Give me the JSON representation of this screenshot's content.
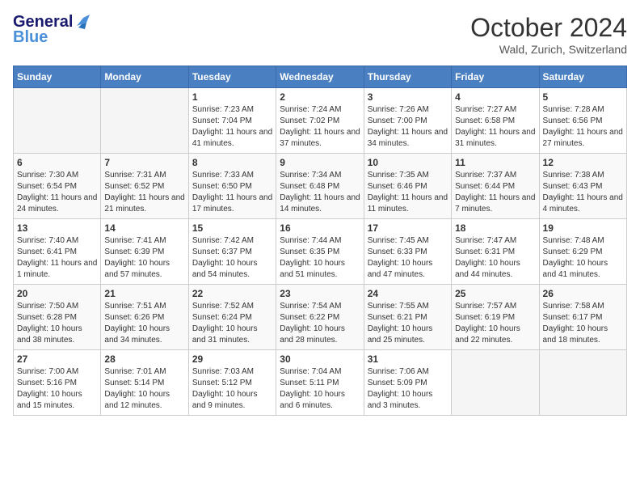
{
  "logo": {
    "general": "General",
    "blue": "Blue"
  },
  "title": "October 2024",
  "location": "Wald, Zurich, Switzerland",
  "headers": [
    "Sunday",
    "Monday",
    "Tuesday",
    "Wednesday",
    "Thursday",
    "Friday",
    "Saturday"
  ],
  "weeks": [
    [
      {
        "day": "",
        "info": ""
      },
      {
        "day": "",
        "info": ""
      },
      {
        "day": "1",
        "info": "Sunrise: 7:23 AM\nSunset: 7:04 PM\nDaylight: 11 hours and 41 minutes."
      },
      {
        "day": "2",
        "info": "Sunrise: 7:24 AM\nSunset: 7:02 PM\nDaylight: 11 hours and 37 minutes."
      },
      {
        "day": "3",
        "info": "Sunrise: 7:26 AM\nSunset: 7:00 PM\nDaylight: 11 hours and 34 minutes."
      },
      {
        "day": "4",
        "info": "Sunrise: 7:27 AM\nSunset: 6:58 PM\nDaylight: 11 hours and 31 minutes."
      },
      {
        "day": "5",
        "info": "Sunrise: 7:28 AM\nSunset: 6:56 PM\nDaylight: 11 hours and 27 minutes."
      }
    ],
    [
      {
        "day": "6",
        "info": "Sunrise: 7:30 AM\nSunset: 6:54 PM\nDaylight: 11 hours and 24 minutes."
      },
      {
        "day": "7",
        "info": "Sunrise: 7:31 AM\nSunset: 6:52 PM\nDaylight: 11 hours and 21 minutes."
      },
      {
        "day": "8",
        "info": "Sunrise: 7:33 AM\nSunset: 6:50 PM\nDaylight: 11 hours and 17 minutes."
      },
      {
        "day": "9",
        "info": "Sunrise: 7:34 AM\nSunset: 6:48 PM\nDaylight: 11 hours and 14 minutes."
      },
      {
        "day": "10",
        "info": "Sunrise: 7:35 AM\nSunset: 6:46 PM\nDaylight: 11 hours and 11 minutes."
      },
      {
        "day": "11",
        "info": "Sunrise: 7:37 AM\nSunset: 6:44 PM\nDaylight: 11 hours and 7 minutes."
      },
      {
        "day": "12",
        "info": "Sunrise: 7:38 AM\nSunset: 6:43 PM\nDaylight: 11 hours and 4 minutes."
      }
    ],
    [
      {
        "day": "13",
        "info": "Sunrise: 7:40 AM\nSunset: 6:41 PM\nDaylight: 11 hours and 1 minute."
      },
      {
        "day": "14",
        "info": "Sunrise: 7:41 AM\nSunset: 6:39 PM\nDaylight: 10 hours and 57 minutes."
      },
      {
        "day": "15",
        "info": "Sunrise: 7:42 AM\nSunset: 6:37 PM\nDaylight: 10 hours and 54 minutes."
      },
      {
        "day": "16",
        "info": "Sunrise: 7:44 AM\nSunset: 6:35 PM\nDaylight: 10 hours and 51 minutes."
      },
      {
        "day": "17",
        "info": "Sunrise: 7:45 AM\nSunset: 6:33 PM\nDaylight: 10 hours and 47 minutes."
      },
      {
        "day": "18",
        "info": "Sunrise: 7:47 AM\nSunset: 6:31 PM\nDaylight: 10 hours and 44 minutes."
      },
      {
        "day": "19",
        "info": "Sunrise: 7:48 AM\nSunset: 6:29 PM\nDaylight: 10 hours and 41 minutes."
      }
    ],
    [
      {
        "day": "20",
        "info": "Sunrise: 7:50 AM\nSunset: 6:28 PM\nDaylight: 10 hours and 38 minutes."
      },
      {
        "day": "21",
        "info": "Sunrise: 7:51 AM\nSunset: 6:26 PM\nDaylight: 10 hours and 34 minutes."
      },
      {
        "day": "22",
        "info": "Sunrise: 7:52 AM\nSunset: 6:24 PM\nDaylight: 10 hours and 31 minutes."
      },
      {
        "day": "23",
        "info": "Sunrise: 7:54 AM\nSunset: 6:22 PM\nDaylight: 10 hours and 28 minutes."
      },
      {
        "day": "24",
        "info": "Sunrise: 7:55 AM\nSunset: 6:21 PM\nDaylight: 10 hours and 25 minutes."
      },
      {
        "day": "25",
        "info": "Sunrise: 7:57 AM\nSunset: 6:19 PM\nDaylight: 10 hours and 22 minutes."
      },
      {
        "day": "26",
        "info": "Sunrise: 7:58 AM\nSunset: 6:17 PM\nDaylight: 10 hours and 18 minutes."
      }
    ],
    [
      {
        "day": "27",
        "info": "Sunrise: 7:00 AM\nSunset: 5:16 PM\nDaylight: 10 hours and 15 minutes."
      },
      {
        "day": "28",
        "info": "Sunrise: 7:01 AM\nSunset: 5:14 PM\nDaylight: 10 hours and 12 minutes."
      },
      {
        "day": "29",
        "info": "Sunrise: 7:03 AM\nSunset: 5:12 PM\nDaylight: 10 hours and 9 minutes."
      },
      {
        "day": "30",
        "info": "Sunrise: 7:04 AM\nSunset: 5:11 PM\nDaylight: 10 hours and 6 minutes."
      },
      {
        "day": "31",
        "info": "Sunrise: 7:06 AM\nSunset: 5:09 PM\nDaylight: 10 hours and 3 minutes."
      },
      {
        "day": "",
        "info": ""
      },
      {
        "day": "",
        "info": ""
      }
    ]
  ]
}
